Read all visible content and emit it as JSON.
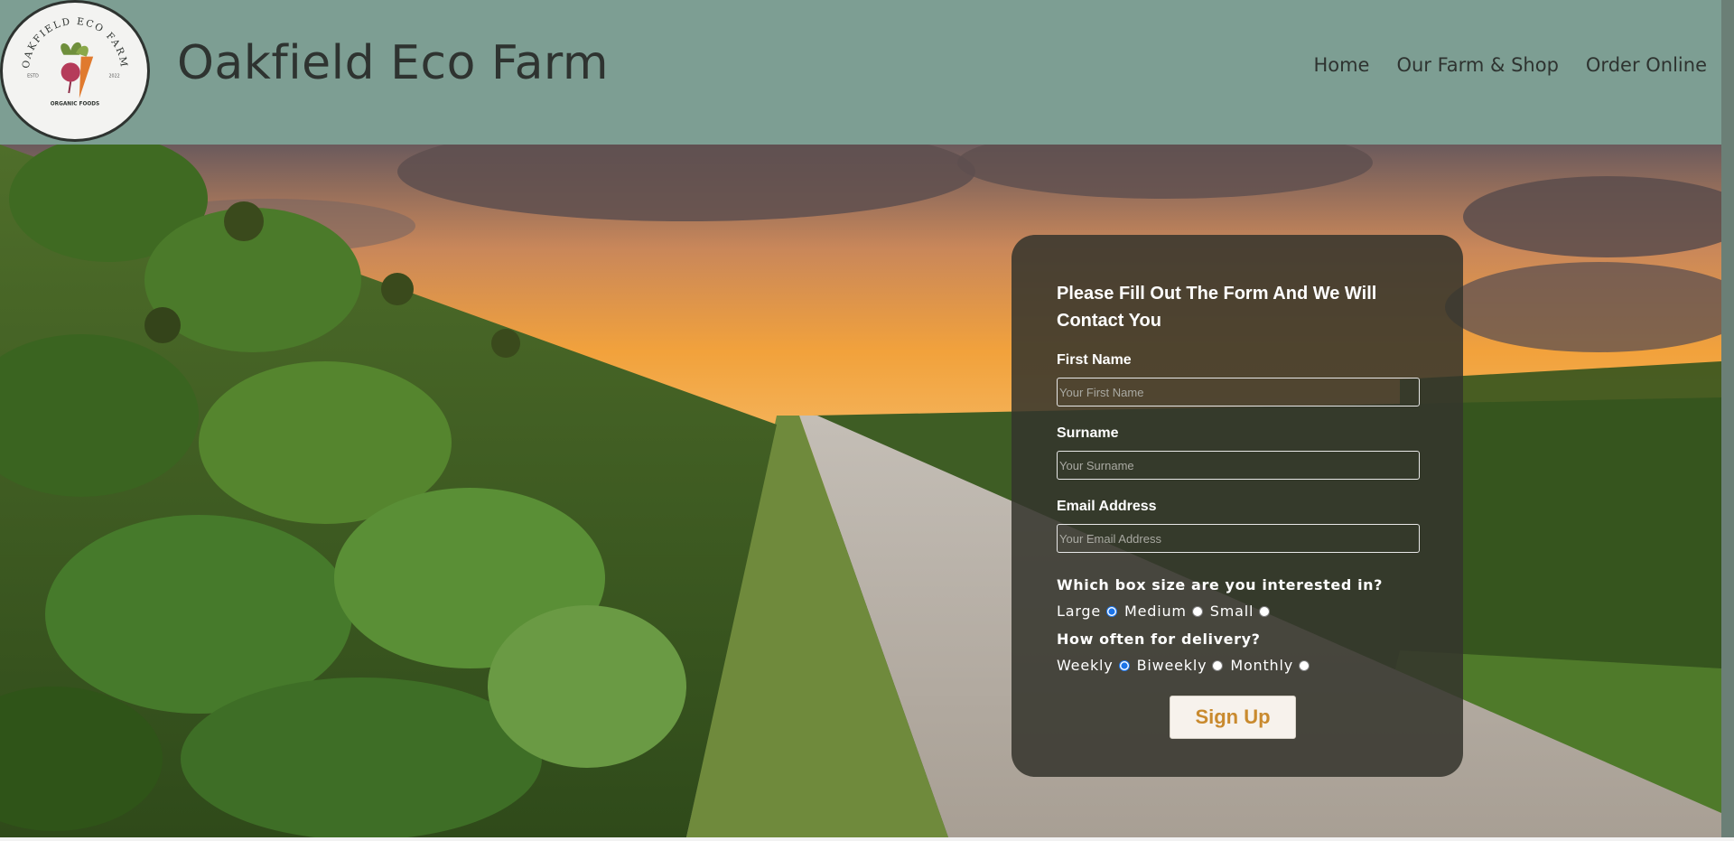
{
  "header": {
    "logo": {
      "ring_text": "OAKFIELD ECO FARM",
      "est_label": "ESTD",
      "est_year": "2022",
      "tagline": "ORGANIC FOODS"
    },
    "title": "Oakfield Eco Farm",
    "nav": [
      {
        "label": "Home"
      },
      {
        "label": "Our Farm & Shop"
      },
      {
        "label": "Order Online"
      }
    ]
  },
  "form": {
    "title": "Please Fill Out The Form And We Will Contact You",
    "first_name": {
      "label": "First Name",
      "placeholder": "Your First Name",
      "value": ""
    },
    "surname": {
      "label": "Surname",
      "placeholder": "Your Surname",
      "value": ""
    },
    "email": {
      "label": "Email Address",
      "placeholder": "Your Email Address",
      "value": ""
    },
    "box_size": {
      "question": "Which box size are you interested in?",
      "options": [
        {
          "label": "Large",
          "checked": true
        },
        {
          "label": "Medium",
          "checked": false
        },
        {
          "label": "Small",
          "checked": false
        }
      ]
    },
    "delivery": {
      "question": "How often for delivery?",
      "options": [
        {
          "label": "Weekly",
          "checked": true
        },
        {
          "label": "Biweekly",
          "checked": false
        },
        {
          "label": "Monthly",
          "checked": false
        }
      ]
    },
    "submit_label": "Sign Up"
  },
  "colors": {
    "header_bg": "#7d9e93",
    "panel_bg": "#34342c",
    "button_text": "#c98a2e",
    "title_text": "#2e3330"
  },
  "icons": {
    "logo": "carrot-radish-logo-icon",
    "hero": "sunflower-field-sunset-image"
  }
}
